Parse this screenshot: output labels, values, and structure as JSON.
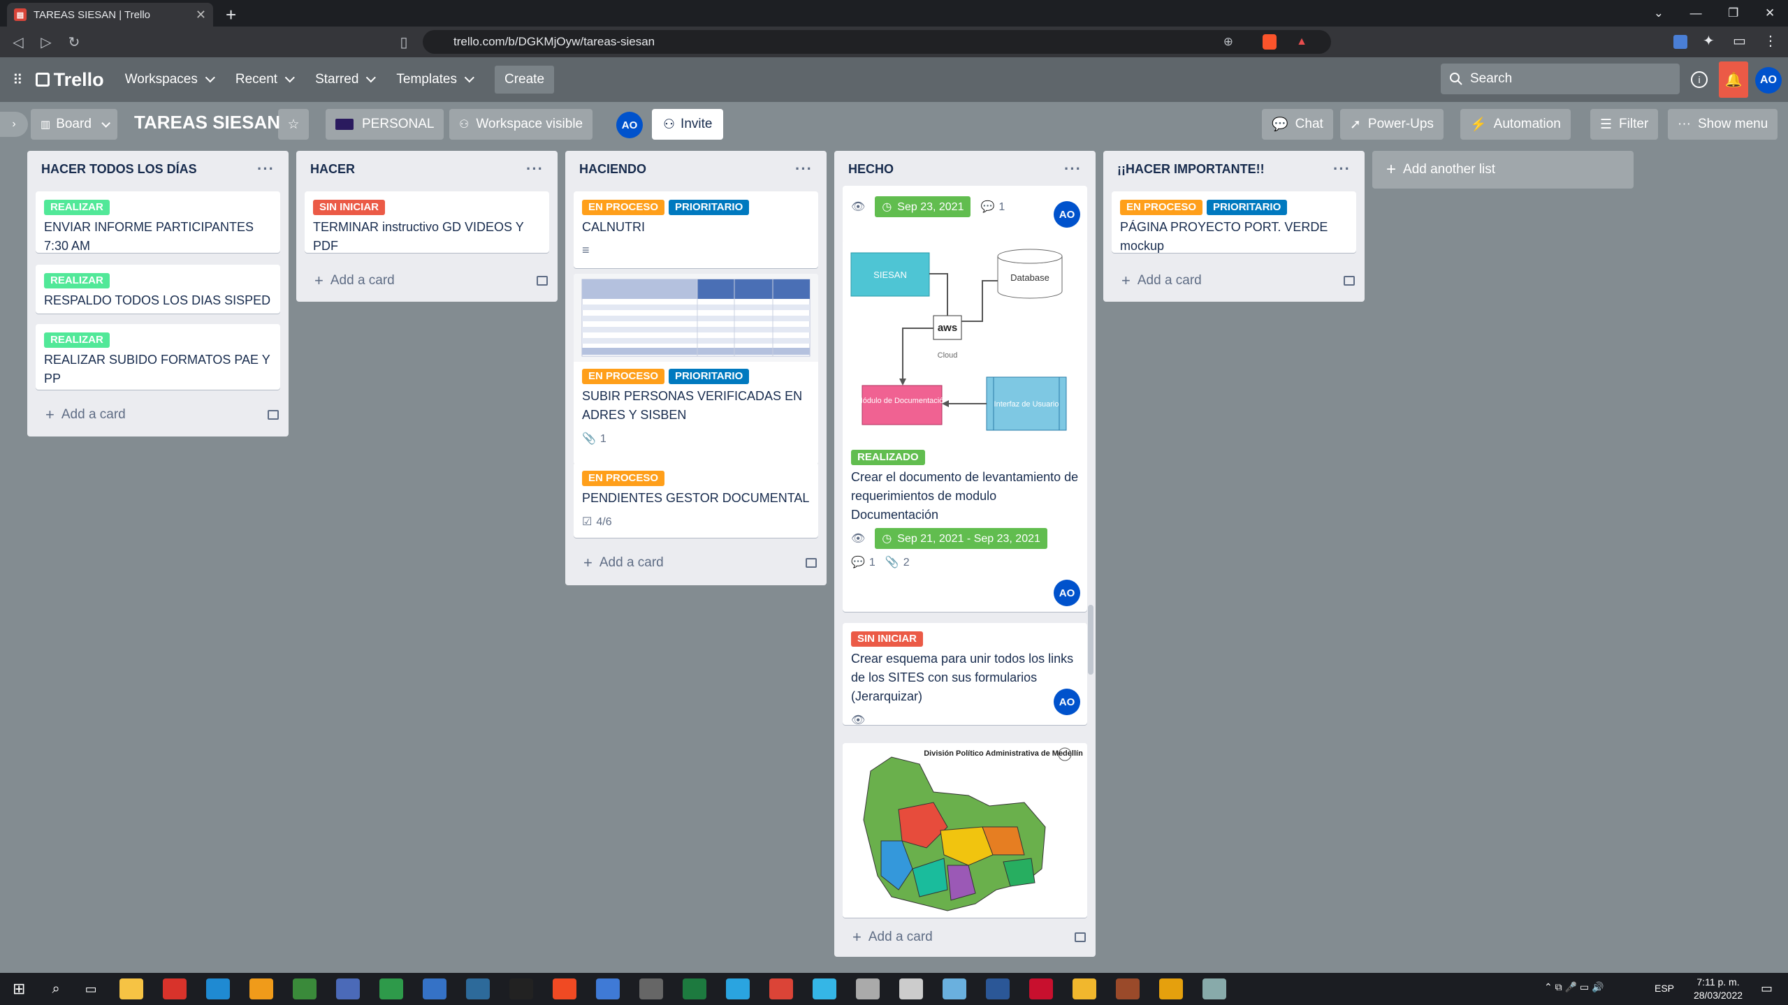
{
  "browser": {
    "tab_title": "TAREAS SIESAN | Trello",
    "url": "trello.com/b/DGKMjOyw/tareas-siesan",
    "new_tab": "+"
  },
  "header": {
    "logo": "Trello",
    "nav": [
      "Workspaces",
      "Recent",
      "Starred",
      "Templates"
    ],
    "create": "Create",
    "search_placeholder": "Search",
    "avatar": "AO"
  },
  "board": {
    "view": "Board",
    "title": "TAREAS SIESAN",
    "workspace": "PERSONAL",
    "visibility": "Workspace visible",
    "member": "AO",
    "invite": "Invite",
    "chat": "Chat",
    "powerups": "Power-Ups",
    "automation": "Automation",
    "filter": "Filter",
    "show_menu": "Show menu"
  },
  "lists": [
    {
      "title": "HACER TODOS LOS DÍAS",
      "add": "Add a card",
      "cards": [
        {
          "label": "REALIZAR",
          "title": "ENVIAR INFORME PARTICIPANTES 7:30 AM"
        },
        {
          "label": "REALIZAR",
          "title": "RESPALDO TODOS LOS DIAS SISPED"
        },
        {
          "label": "REALIZAR",
          "title": "REALIZAR SUBIDO FORMATOS PAE Y PP"
        }
      ]
    },
    {
      "title": "HACER",
      "add": "Add a card",
      "cards": [
        {
          "label": "SIN INICIAR",
          "title": "TERMINAR instructivo GD VIDEOS Y PDF"
        }
      ]
    },
    {
      "title": "HACIENDO",
      "add": "Add a card",
      "cards": [
        {
          "labels": [
            "EN PROCESO",
            "PRIORITARIO"
          ],
          "title": "CALNUTRI"
        },
        {
          "labels": [
            "EN PROCESO",
            "PRIORITARIO"
          ],
          "title": "SUBIR PERSONAS VERIFICADAS EN ADRES Y SISBEN",
          "attachments": "1"
        },
        {
          "labels": [
            "EN PROCESO"
          ],
          "title": "PENDIENTES GESTOR DOCUMENTAL",
          "checklist": "4/6"
        }
      ]
    },
    {
      "title": "HECHO",
      "add": "Add a card",
      "cards": [
        {
          "due": "Sep 23, 2021",
          "comments": "1",
          "member": "AO"
        },
        {
          "diagram": {
            "siesan": "SIESAN",
            "database": "Database",
            "aws": "aws",
            "cloud": "Cloud",
            "modulo": "Módulo de Documentación",
            "interfaz": "Interfaz de Usuario"
          },
          "label": "REALIZADO",
          "title": "Crear el documento de levantamiento de requerimientos de modulo Documentación",
          "due": "Sep 21, 2021 - Sep 23, 2021",
          "comments": "1",
          "attachments": "2",
          "member": "AO"
        },
        {
          "label": "SIN INICIAR",
          "title": "Crear esquema para unir todos los links de los SITES con sus formularios (Jerarquizar)",
          "member": "AO"
        },
        {
          "map_title": "División Político Administrativa de Medellín"
        }
      ]
    },
    {
      "title": "¡¡HACER IMPORTANTE!!",
      "add": "Add a card",
      "cards": [
        {
          "labels": [
            "EN PROCESO",
            "PRIORITARIO"
          ],
          "title": "PÁGINA PROYECTO PORT. VERDE mockup"
        }
      ]
    }
  ],
  "add_list": "Add another list",
  "taskbar": {
    "time": "7:11 p. m.",
    "date": "28/03/2022",
    "lang": "ESP"
  }
}
